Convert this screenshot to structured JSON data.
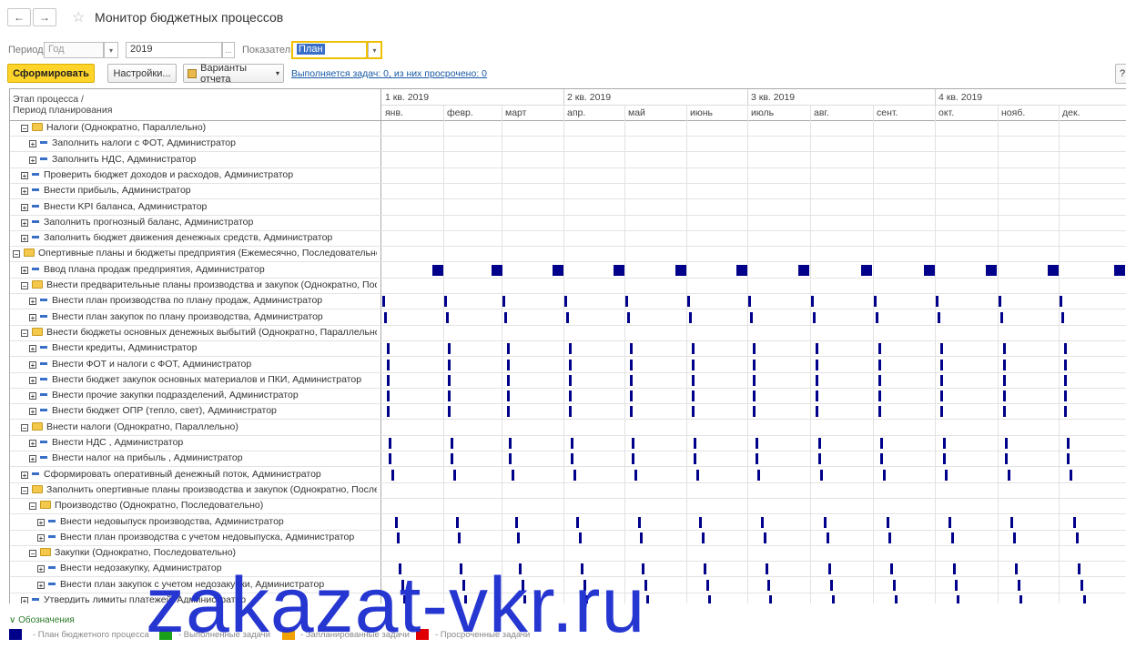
{
  "window": {
    "title": "Монитор бюджетных процессов"
  },
  "filters": {
    "period_label": "Период:",
    "period_value": "Год",
    "year_value": "2019",
    "year_btn": "...",
    "indicators_label": "Показатели:",
    "indicators_value": "План"
  },
  "toolbar": {
    "generate_label": "Сформировать",
    "settings_label": "Настройки...",
    "variants_label": "Варианты отчета",
    "tasks_link": "Выполняется задач: 0, из них просрочено: 0",
    "help_label": "?"
  },
  "grid": {
    "col_header_1": "Этап процесса /",
    "col_header_2": "Период планирования",
    "quarters": [
      "1 кв. 2019",
      "2 кв. 2019",
      "3 кв. 2019",
      "4 кв. 2019"
    ],
    "months": [
      "янв.",
      "февр.",
      "март",
      "апр.",
      "май",
      "июнь",
      "июль",
      "авг.",
      "сент.",
      "окт.",
      "нояб.",
      "дек."
    ],
    "rows": [
      {
        "level": 1,
        "icon": "folder",
        "exp": "⊟",
        "text": "Налоги (Однократно, Параллельно)",
        "mark": "none"
      },
      {
        "level": 2,
        "icon": "dash",
        "exp": "⊞",
        "text": "Заполнить налоги с ФОТ, Администратор",
        "mark": "none"
      },
      {
        "level": 2,
        "icon": "dash",
        "exp": "⊞",
        "text": "Заполнить НДС, Администратор",
        "mark": "none"
      },
      {
        "level": 1,
        "icon": "dash",
        "exp": "⊞",
        "text": "Проверить бюджет доходов и расходов, Администратор",
        "mark": "none"
      },
      {
        "level": 1,
        "icon": "dash",
        "exp": "⊞",
        "text": "Внести прибыль, Администратор",
        "mark": "none"
      },
      {
        "level": 1,
        "icon": "dash",
        "exp": "⊞",
        "text": "Внести KPI баланса, Администратор",
        "mark": "none"
      },
      {
        "level": 1,
        "icon": "dash",
        "exp": "⊞",
        "text": "Заполнить прогнозный баланс, Администратор",
        "mark": "none"
      },
      {
        "level": 1,
        "icon": "dash",
        "exp": "⊞",
        "text": "Заполнить бюджет движения денежных средств, Администратор",
        "mark": "none"
      },
      {
        "level": 0,
        "icon": "folder",
        "exp": "⊟",
        "text": "Опертивные планы и бюджеты предприятия (Ежемесячно, Последовательно)",
        "mark": "none"
      },
      {
        "level": 1,
        "icon": "dash",
        "exp": "⊞",
        "text": "Ввод плана продаж предприятия, Администратор",
        "mark": "square",
        "offset": 0.7
      },
      {
        "level": 1,
        "icon": "folder",
        "exp": "⊟",
        "text": "Внести предварительные планы производства и закупок (Однократно, После...",
        "mark": "none"
      },
      {
        "level": 2,
        "icon": "dash",
        "exp": "⊞",
        "text": "Внести план производства по плану продаж, Администратор",
        "mark": "bar",
        "offset": 0.0
      },
      {
        "level": 2,
        "icon": "dash",
        "exp": "⊞",
        "text": "Внести план закупок по плану производства, Администратор",
        "mark": "bar",
        "offset": 0.03
      },
      {
        "level": 1,
        "icon": "folder",
        "exp": "⊟",
        "text": "Внести бюджеты основных денежных выбытий (Однократно, Параллельно)",
        "mark": "none"
      },
      {
        "level": 2,
        "icon": "dash",
        "exp": "⊞",
        "text": "Внести кредиты, Администратор",
        "mark": "bar",
        "offset": 0.07
      },
      {
        "level": 2,
        "icon": "dash",
        "exp": "⊞",
        "text": "Внести ФОТ и налоги с ФОТ, Администратор",
        "mark": "bar",
        "offset": 0.07
      },
      {
        "level": 2,
        "icon": "dash",
        "exp": "⊞",
        "text": "Внести бюджет закупок основных материалов и ПКИ, Администратор",
        "mark": "bar",
        "offset": 0.07
      },
      {
        "level": 2,
        "icon": "dash",
        "exp": "⊞",
        "text": "Внести прочие закупки подразделений, Администратор",
        "mark": "bar",
        "offset": 0.07
      },
      {
        "level": 2,
        "icon": "dash",
        "exp": "⊞",
        "text": "Внести бюджет ОПР (тепло, свет), Администратор",
        "mark": "bar",
        "offset": 0.07
      },
      {
        "level": 1,
        "icon": "folder",
        "exp": "⊟",
        "text": "Внести налоги (Однократно, Параллельно)",
        "mark": "none"
      },
      {
        "level": 2,
        "icon": "dash",
        "exp": "⊞",
        "text": "Внести НДС , Администратор",
        "mark": "bar",
        "offset": 0.11
      },
      {
        "level": 2,
        "icon": "dash",
        "exp": "⊞",
        "text": "Внести налог на прибыль , Администратор",
        "mark": "bar",
        "offset": 0.11
      },
      {
        "level": 1,
        "icon": "dash",
        "exp": "⊞",
        "text": "Сформировать оперативный денежный поток, Администратор",
        "mark": "bar",
        "offset": 0.15
      },
      {
        "level": 1,
        "icon": "folder",
        "exp": "⊟",
        "text": "Заполнить опертивные планы производства и закупок (Однократно, Послед...",
        "mark": "none"
      },
      {
        "level": 2,
        "icon": "folder",
        "exp": "⊟",
        "text": "Производство (Однократно, Последовательно)",
        "mark": "none"
      },
      {
        "level": 3,
        "icon": "dash",
        "exp": "⊞",
        "text": "Внести недовыпуск производства, Администратор",
        "mark": "bar",
        "offset": 0.2
      },
      {
        "level": 3,
        "icon": "dash",
        "exp": "⊞",
        "text": "Внести план производства с учетом недовыпуска, Администратор",
        "mark": "bar",
        "offset": 0.24
      },
      {
        "level": 2,
        "icon": "folder",
        "exp": "⊟",
        "text": "Закупки (Однократно, Последовательно)",
        "mark": "none"
      },
      {
        "level": 3,
        "icon": "dash",
        "exp": "⊞",
        "text": "Внести недозакупку, Администратор",
        "mark": "bar",
        "offset": 0.27
      },
      {
        "level": 3,
        "icon": "dash",
        "exp": "⊞",
        "text": "Внести план закупок с учетом недозакупки, Администратор",
        "mark": "bar",
        "offset": 0.31
      },
      {
        "level": 1,
        "icon": "dash",
        "exp": "⊞",
        "text": "Утвердить лимиты платежей, Администратор",
        "mark": "bar",
        "offset": 0.34
      }
    ]
  },
  "legend": {
    "toggle": "Обозначения",
    "items": [
      {
        "color": "#00008b",
        "text": "- План бюджетного процесса"
      },
      {
        "color": "#1aa01a",
        "text": "- Выполненные задачи"
      },
      {
        "color": "#f0a000",
        "text": "- Запланированные задачи"
      },
      {
        "color": "#e00000",
        "text": "- Просроченные задачи"
      }
    ]
  },
  "watermark": "zakazat-vkr.ru"
}
